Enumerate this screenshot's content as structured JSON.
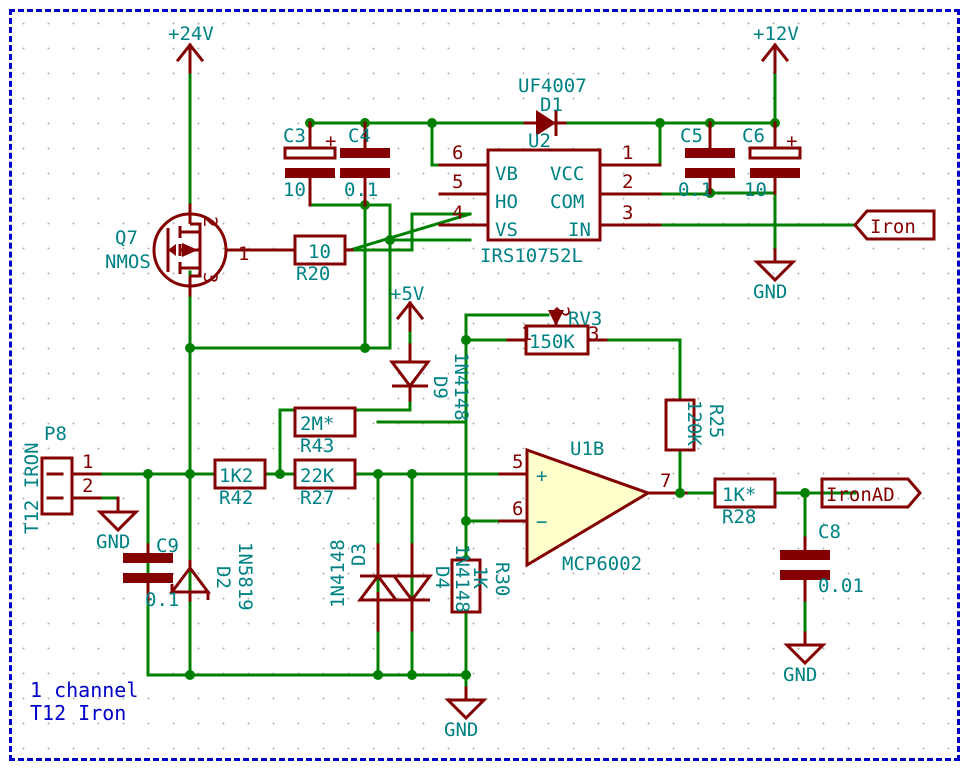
{
  "sheet": {
    "title_note_line1": "1 channel",
    "title_note_line2": "T12 Iron",
    "border_color": "#0000c8",
    "wire_color": "#008000",
    "part_color": "#840000",
    "text_color": "#008284"
  },
  "power": {
    "p24v": "+24V",
    "p12v": "+12V",
    "p5v": "+5V",
    "gnd1": "GND",
    "gnd2": "GND",
    "gnd3": "GND",
    "gnd4": "GND"
  },
  "net_labels": {
    "iron": "Iron",
    "ironad": "IronAD"
  },
  "components": [
    {
      "ref": "C3",
      "value": "10",
      "type": "cap-polarized",
      "polarity": "+"
    },
    {
      "ref": "C4",
      "value": "0.1",
      "type": "cap"
    },
    {
      "ref": "C5",
      "value": "0.1",
      "type": "cap"
    },
    {
      "ref": "C6",
      "value": "10",
      "type": "cap-polarized",
      "polarity": "+"
    },
    {
      "ref": "C8",
      "value": "0.01",
      "type": "cap"
    },
    {
      "ref": "C9",
      "value": "0.1",
      "type": "cap"
    },
    {
      "ref": "D1",
      "value": "UF4007",
      "type": "diode"
    },
    {
      "ref": "D2",
      "value": "1N5819",
      "type": "schottky"
    },
    {
      "ref": "D3",
      "value": "1N4148",
      "type": "diode"
    },
    {
      "ref": "D4",
      "value": "1N4148",
      "type": "diode"
    },
    {
      "ref": "D9",
      "value": "1N4148",
      "type": "diode"
    },
    {
      "ref": "P8",
      "value": "T12 IRON",
      "type": "connector",
      "pins": [
        "1",
        "2"
      ]
    },
    {
      "ref": "Q7",
      "value": "NMOS",
      "type": "mosfet",
      "pins": [
        "1",
        "2",
        "3"
      ]
    },
    {
      "ref": "R20",
      "value": "10",
      "type": "resistor"
    },
    {
      "ref": "R25",
      "value": "120K",
      "type": "resistor"
    },
    {
      "ref": "R27",
      "value": "22K",
      "type": "resistor"
    },
    {
      "ref": "R28",
      "value": "1K*",
      "type": "resistor"
    },
    {
      "ref": "R30",
      "value": "1K",
      "type": "resistor"
    },
    {
      "ref": "R42",
      "value": "1K2",
      "type": "resistor"
    },
    {
      "ref": "R43",
      "value": "2M*",
      "type": "resistor"
    },
    {
      "ref": "RV3",
      "value": "150K",
      "type": "potentiometer",
      "pins": [
        "1",
        "2",
        "3"
      ]
    },
    {
      "ref": "U1B",
      "value": "MCP6002",
      "type": "opamp",
      "pins": [
        "5",
        "6",
        "7"
      ]
    },
    {
      "ref": "U2",
      "value": "IRS10752L",
      "type": "ic",
      "pins_left": [
        {
          "num": "6",
          "name": "VB"
        },
        {
          "num": "5",
          "name": "HO"
        },
        {
          "num": "4",
          "name": "VS"
        }
      ],
      "pins_right": [
        {
          "num": "1",
          "name": "VCC"
        },
        {
          "num": "2",
          "name": "COM"
        },
        {
          "num": "3",
          "name": "IN"
        }
      ]
    }
  ],
  "labels": {
    "c3_ref": "C3",
    "c3_val": "10",
    "c3_plus": "+",
    "c4_ref": "C4",
    "c4_val": "0.1",
    "c5_ref": "C5",
    "c5_val": "0.1",
    "c6_ref": "C6",
    "c6_val": "10",
    "c6_plus": "+",
    "c8_ref": "C8",
    "c8_val": "0.01",
    "c9_ref": "C9",
    "c9_val": "0.1",
    "d1_ref": "D1",
    "d1_val": "UF4007",
    "d2_ref": "D2",
    "d2_val": "1N5819",
    "d3_ref": "D3",
    "d3_val": "1N4148",
    "d4_ref": "D4",
    "d4_val": "1N4148",
    "d9_ref": "D9",
    "d9_val": "1N4148",
    "p8_ref": "P8",
    "p8_val": "T12 IRON",
    "p8_pin1": "1",
    "p8_pin2": "2",
    "q7_ref": "Q7",
    "q7_val": "NMOS",
    "q7_pin1": "1",
    "q7_pin2": "2",
    "q7_pin3": "3",
    "r20_ref": "R20",
    "r20_val": "10",
    "r25_ref": "R25",
    "r25_val": "120K",
    "r27_ref": "R27",
    "r27_val": "22K",
    "r28_ref": "R28",
    "r28_val": "1K*",
    "r30_ref": "R30",
    "r30_val": "1K",
    "r42_ref": "R42",
    "r42_val": "1K2",
    "r43_ref": "R43",
    "r43_val": "2M*",
    "rv3_ref": "RV3",
    "rv3_val": "150K",
    "rv3_pin1": "1",
    "rv3_pin2": "2",
    "rv3_pin3": "3",
    "u1b_ref": "U1B",
    "u1b_val": "MCP6002",
    "u1b_pin5": "5",
    "u1b_pin6": "6",
    "u1b_pin7": "7",
    "u1b_plus": "+",
    "u1b_minus": "−",
    "u2_ref": "U2",
    "u2_val": "IRS10752L",
    "u2_p6": "6",
    "u2_p5": "5",
    "u2_p4": "4",
    "u2_p1": "1",
    "u2_p2": "2",
    "u2_p3": "3",
    "u2_vb": "VB",
    "u2_ho": "HO",
    "u2_vs": "VS",
    "u2_vcc": "VCC",
    "u2_com": "COM",
    "u2_in": "IN"
  }
}
